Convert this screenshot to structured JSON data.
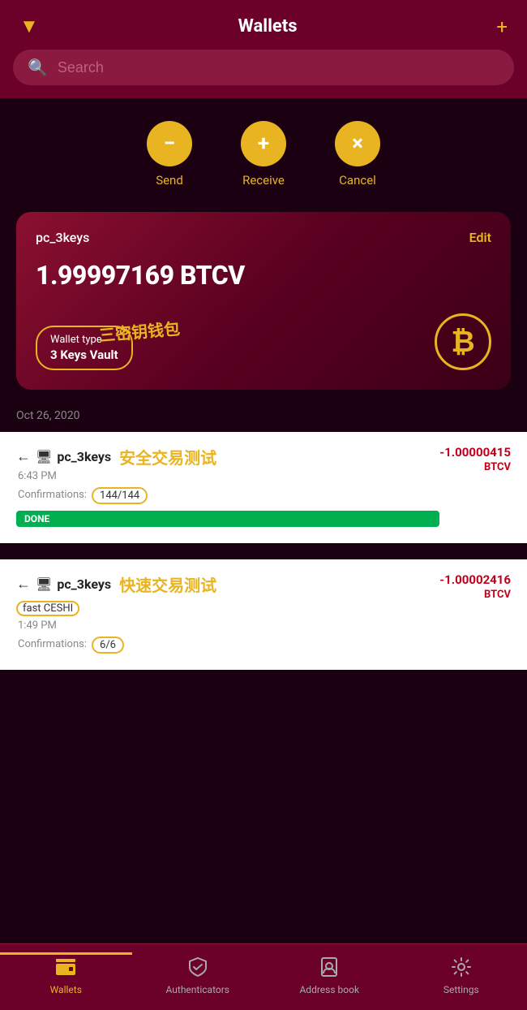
{
  "header": {
    "title": "Wallets",
    "filter_icon": "▼",
    "add_icon": "+"
  },
  "search": {
    "placeholder": "Search"
  },
  "actions": [
    {
      "id": "send",
      "icon": "−",
      "label": "Send"
    },
    {
      "id": "receive",
      "icon": "+",
      "label": "Receive"
    },
    {
      "id": "cancel",
      "icon": "×",
      "label": "Cancel"
    }
  ],
  "wallet_card": {
    "name": "pc_3keys",
    "edit_label": "Edit",
    "balance": "1.99997169 BTCV",
    "wallet_type_label": "Wallet type",
    "wallet_type_value": "3 Keys Vault",
    "chinese_label": "三密钥钱包",
    "bitcoin_symbol": "₿"
  },
  "section_date": "Oct 26, 2020",
  "transactions": [
    {
      "id": "tx1",
      "arrow": "←",
      "wallet_icon": "🖥",
      "name": "pc_3keys",
      "chinese": "安全交易测试",
      "time": "6:43 PM",
      "confirmations_label": "Confirmations:",
      "confirmations_value": "144/144",
      "status": "DONE",
      "amount": "-1.00000415",
      "currency": "BTCV"
    },
    {
      "id": "tx2",
      "arrow": "←",
      "wallet_icon": "🖥",
      "name": "pc_3keys",
      "chinese": "快速交易测试",
      "fast_label": "fast CESHI",
      "time": "1:49 PM",
      "confirmations_label": "Confirmations:",
      "confirmations_value": "6/6",
      "amount": "-1.00002416",
      "currency": "BTCV"
    }
  ],
  "bottom_nav": {
    "items": [
      {
        "id": "wallets",
        "icon": "▦",
        "label": "Wallets",
        "active": true
      },
      {
        "id": "authenticators",
        "icon": "🛡",
        "label": "Authenticators",
        "active": false
      },
      {
        "id": "address_book",
        "icon": "👤",
        "label": "Address book",
        "active": false
      },
      {
        "id": "settings",
        "icon": "⚙",
        "label": "Settings",
        "active": false
      }
    ]
  }
}
